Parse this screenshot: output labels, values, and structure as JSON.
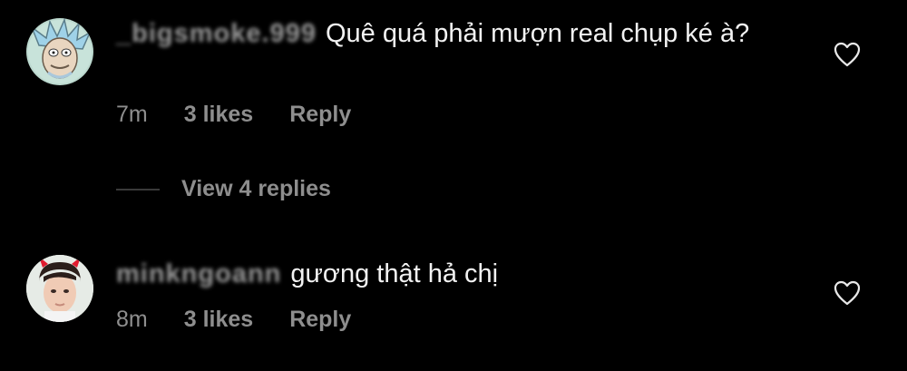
{
  "comments": [
    {
      "username": "_bigsmoke.999",
      "text": "Quê quá phải mượn real chụp ké à?",
      "time": "7m",
      "likes": "3 likes",
      "reply": "Reply",
      "view_replies": "View 4 replies"
    },
    {
      "username": "minkngoann",
      "text": "gương thật hả chị",
      "time": "8m",
      "likes": "3 likes",
      "reply": "Reply"
    }
  ],
  "icons": {
    "like": "heart-icon"
  },
  "colors": {
    "background": "#000000",
    "text": "#f2f2f2",
    "secondary": "#8e8e8e"
  }
}
